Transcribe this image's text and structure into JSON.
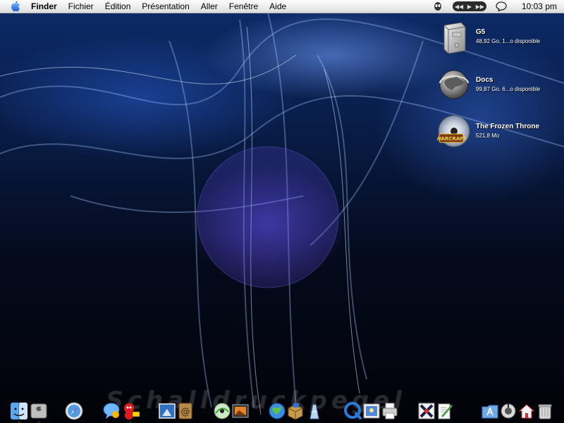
{
  "menubar": {
    "app_name": "Finder",
    "menus": [
      "Fichier",
      "Édition",
      "Présentation",
      "Aller",
      "Fenêtre",
      "Aide"
    ],
    "clock": "10:03 pm"
  },
  "desktop": {
    "volumes": [
      {
        "name": "G5",
        "info": "48,92 Go, 1...o disponible",
        "icon": "hard-drive-icon"
      },
      {
        "name": "Docs",
        "info": "99,87 Go, 6...o disponible",
        "icon": "globe-disk-icon"
      },
      {
        "name": "The Frozen Throne",
        "info": "521,8 Mo",
        "icon": "warcraft-cd-icon"
      }
    ],
    "watermark": "Schalldruckpegel"
  },
  "dock": {
    "apps": [
      "finder-icon",
      "system-preferences-icon",
      "safari-icon",
      "ichat-icon",
      "adium-icon",
      "iphoto-icon",
      "address-book-icon",
      "cd-burner-icon",
      "image-capture-icon",
      "network-globe-icon",
      "stuffit-icon",
      "cleaner-icon",
      "quicktime-icon",
      "preview-icon",
      "printer-icon",
      "x11-icon",
      "textedit-icon",
      "applications-folder-icon",
      "downloads-folder-icon",
      "home-folder-icon",
      "trash-icon"
    ]
  },
  "colors": {
    "menubar": "#ececec",
    "wallpaper": "#0c2a66",
    "accent": "#3a7bd5"
  }
}
